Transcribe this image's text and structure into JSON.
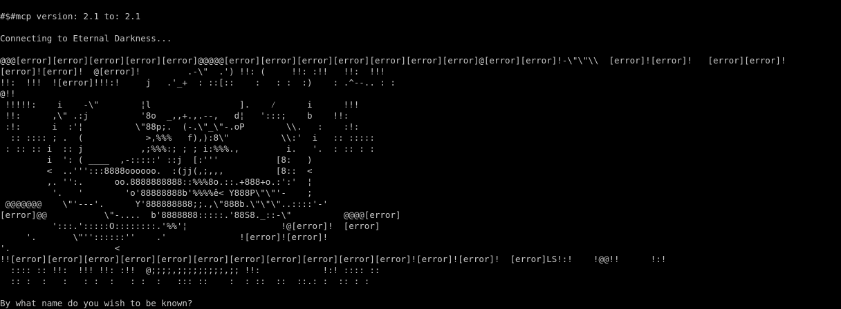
{
  "terminal": {
    "version_line": "#$#mcp version: 2.1 to: 2.1",
    "connect_line": "Connecting to Eternal Darkness...",
    "art_lines": [
      "@@@[error][error][error][error][error]@@@@@[error][error][error][error][error][error][error]@[error][error]!-\\\"\\\"\\\\  [error]![error]!   [error][error]!",
      "[error]![error]!  @[error]!         .-\\\"  .') !!: (     !!: :!!   !!:  !!!",
      "!!:  !!!  ![error]!!!:!     j   .'_+  : ::[::    :   : :  :)    : .^--.. : :",
      "@!!",
      " !!!!!:    i    -\\\"        ¦l                 ].    ⁄      i      !!!",
      " !!:      ,\\\" .:j          '8o  _,,+.,.--,   d¦   ':::;    b    !!:",
      " :!:      i  :'¦          \\\"88p;.  (-.\\\"_\\\"-.oP        \\\\.   :    :!:",
      "  :: :::: ; .  (            >,%%%   f),):8\\\"          \\\\:'  i   :: :::::",
      " : :: :: i  :: j           ,;%%%:; ; ; i:%%%.,         i.   '.  : :: : :",
      "         i  ': ( ____  ,-:::::' ::j  [:'''           [8:   )",
      "         <  ..''':::8888oooooo.  :(jj(,;,,,          [8::  <",
      "         ,. '':.      oo.8888888888::%%%8o.::.+888+o.:':'  ¦",
      "          '.   '        'o'88888888b'%%%%ê< Y888P\\\"\\\"'-    ;",
      " @@@@@@@    \\\"'---'.      Y'888888888;;.,\\\"888b.\\\"\\\"\\\"..::::'-'",
      "[error]@@           \\\"-....  b'8888888:::::.'88S8._::-\\\"          @@@@[error]",
      "          ':::.':::::O::::::::.'%%'¦                  !@[error]!  [error]",
      "     '.       \\\"''::::::''    .'              ![error]![error]!",
      "'.                    <",
      "!![error][error][error][error][error][error][error][error][error][error][error]![error]![error]!  [error]LS!:!    !@@!!      !:!",
      "  :::: :: !!:  !!! !!: :!!  @;;;;,;;;;;;;;;,;; !!:            !:! :::: ::",
      "  :: :  :   :   : :  :   : :  :   ::: ::    :  : ::  ::  ::.: :  :: : :"
    ],
    "prompt": "By what name do you wish to be known?"
  },
  "colors": {
    "background": "#000000",
    "foreground": "#c8c8c8"
  }
}
